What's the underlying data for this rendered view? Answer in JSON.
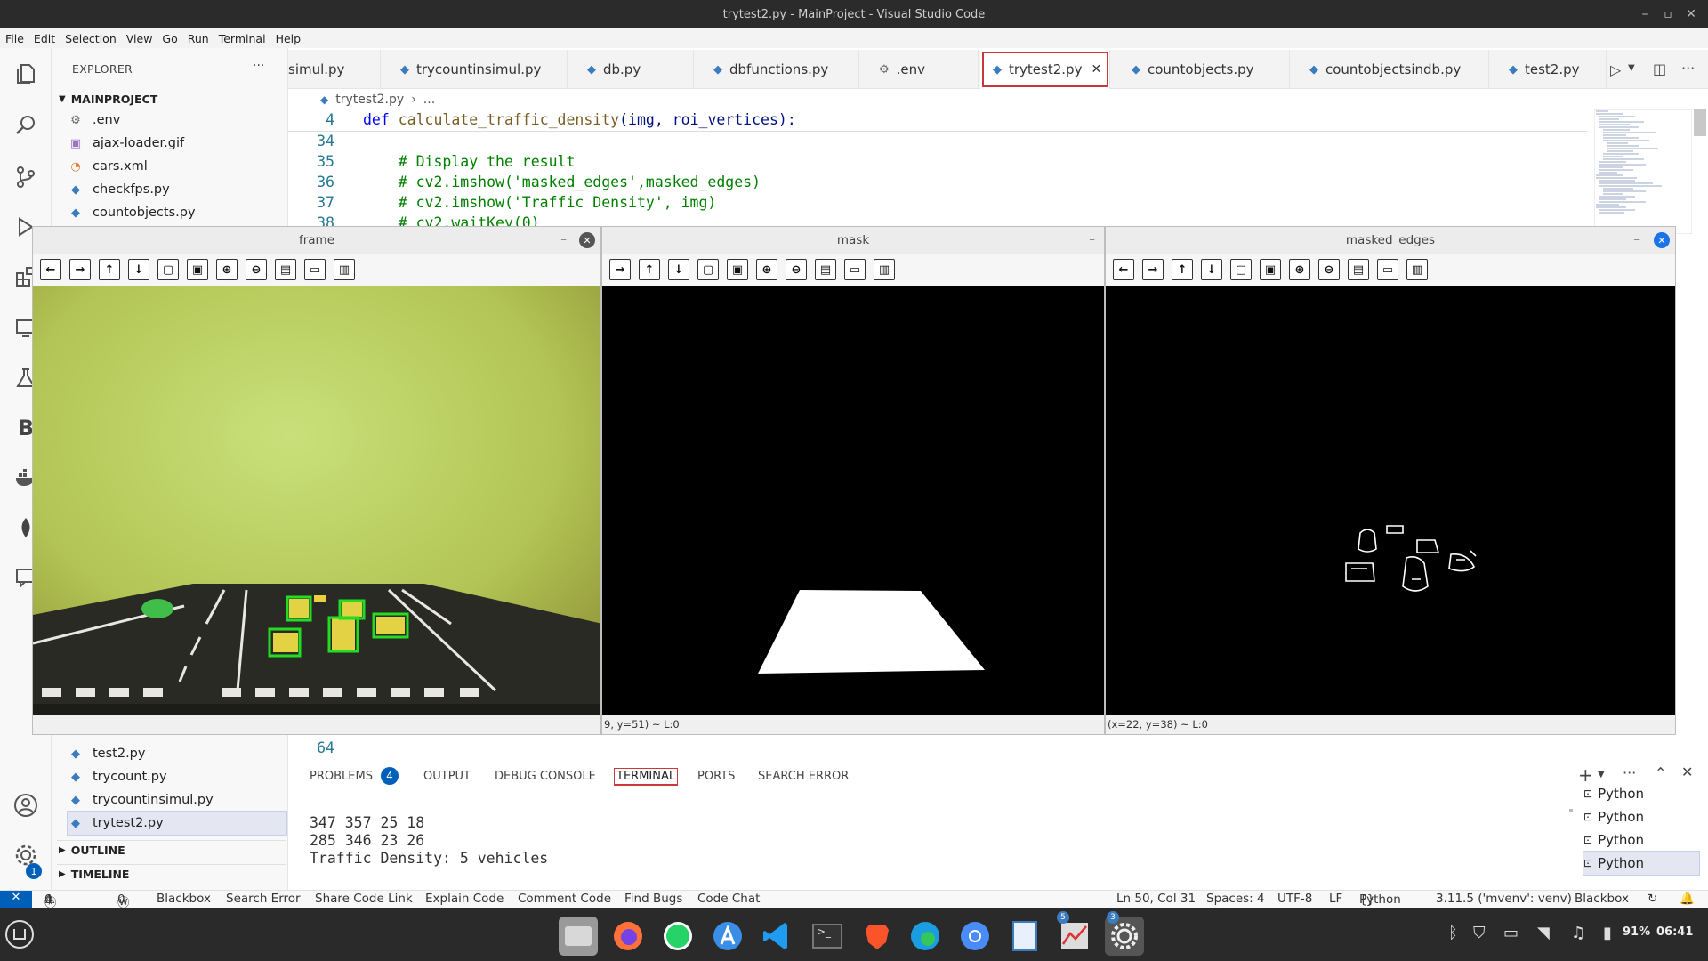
{
  "window": {
    "title": "trytest2.py - MainProject - Visual Studio Code"
  },
  "menu": [
    "File",
    "Edit",
    "Selection",
    "View",
    "Go",
    "Run",
    "Terminal",
    "Help"
  ],
  "explorer": {
    "title": "EXPLORER",
    "more": "···",
    "project": "MAINPROJECT",
    "files_top": [
      {
        "name": ".env",
        "icon": "gear-icon"
      },
      {
        "name": "ajax-loader.gif",
        "icon": "image-icon"
      },
      {
        "name": "cars.xml",
        "icon": "rss-icon"
      },
      {
        "name": "checkfps.py",
        "icon": "python-icon"
      },
      {
        "name": "countobjects.py",
        "icon": "python-icon"
      }
    ],
    "files_bottom": [
      {
        "name": "test2.py"
      },
      {
        "name": "trycount.py"
      },
      {
        "name": "trycountinsimul.py"
      },
      {
        "name": "trytest2.py"
      }
    ],
    "outline": "OUTLINE",
    "timeline": "TIMELINE"
  },
  "tabs": [
    {
      "label": "simul.py"
    },
    {
      "label": "trycountinsimul.py"
    },
    {
      "label": "db.py"
    },
    {
      "label": "dbfunctions.py"
    },
    {
      "label": ".env"
    },
    {
      "label": "trytest2.py"
    },
    {
      "label": "countobjects.py"
    },
    {
      "label": "countobjectsindb.py"
    },
    {
      "label": "test2.py"
    }
  ],
  "breadcrumb": {
    "file": "trytest2.py",
    "rest": "..."
  },
  "editor": {
    "sticky": {
      "ln": "4",
      "kw": "def",
      "fn": "calculate_traffic_density",
      "args": "(img, roi_vertices):"
    },
    "lines": [
      {
        "ln": "34",
        "text": ""
      },
      {
        "ln": "35",
        "text": "    # Display the result"
      },
      {
        "ln": "36",
        "text": "    # cv2.imshow('masked_edges',masked_edges)"
      },
      {
        "ln": "37",
        "text": "    # cv2.imshow('Traffic Density', img)"
      },
      {
        "ln": "38",
        "text": "    # cv2.waitKey(0)"
      }
    ],
    "line64": "64"
  },
  "cv_windows": [
    {
      "title": "frame",
      "status": ""
    },
    {
      "title": "mask",
      "status": "9, y=51) ~ L:0"
    },
    {
      "title": "masked_edges",
      "status": "(x=22, y=38) ~ L:0"
    }
  ],
  "panel": {
    "tabs": [
      "PROBLEMS",
      "OUTPUT",
      "DEBUG CONSOLE",
      "TERMINAL",
      "PORTS",
      "SEARCH ERROR"
    ],
    "problems_count": "4",
    "terminal_lines": [
      "347 357 25 18",
      "285 346 23 26",
      "Traffic Density: 5 vehicles"
    ],
    "terminals": [
      "Python",
      "Python",
      "Python",
      "Python"
    ]
  },
  "status": {
    "errors": "4",
    "warnings": "0",
    "ports": "0",
    "items": [
      "Blackbox",
      "Search Error",
      "Share Code Link",
      "Explain Code",
      "Comment Code",
      "Find Bugs",
      "Code Chat"
    ],
    "position": "Ln 50, Col 31",
    "spaces": "Spaces: 4",
    "encoding": "UTF-8",
    "eol": "LF",
    "language": "Python",
    "interpreter": "3.11.5 ('mvenv': venv)",
    "blackbox": "Blackbox"
  },
  "taskbar": {
    "battery": "91%",
    "time": "06:41",
    "badges": [
      "5",
      "3"
    ]
  }
}
